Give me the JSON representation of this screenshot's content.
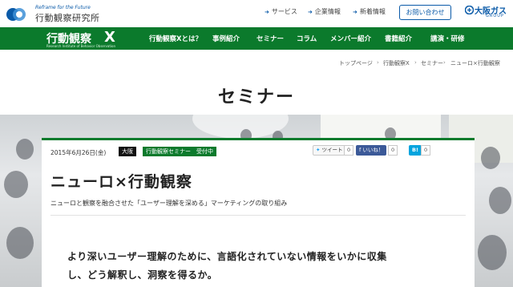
{
  "header": {
    "logo_tagline": "Reframe for the Future",
    "logo_name": "行動観察研究所",
    "utility_links": [
      "サービス",
      "企業情報",
      "新着情報"
    ],
    "contact_label": "お問い合わせ",
    "group_logo": "大阪ガス",
    "group_sub": "GROUP"
  },
  "nav": {
    "logo_text": "行動観察",
    "logo_x": "X",
    "logo_sub": "Research Institute of Behavior Observation",
    "items": [
      "行動観察Xとは？",
      "事例紹介",
      "セミナー",
      "コラム",
      "メンバー紹介",
      "書籍紹介",
      "講演・研修"
    ]
  },
  "breadcrumb": [
    "トップページ",
    "行動観察X",
    "セミナー",
    "ニューロ×行動観察"
  ],
  "page_title": "セミナー",
  "article": {
    "date": "2015年6月26日(金)",
    "area_tag": "大阪",
    "category_tag": "行動観察セミナー　受付中",
    "share": {
      "tweet_label": "ツイート",
      "tweet_count": "0",
      "like_label": "いいね！",
      "like_count": "0",
      "hatena_label": "B!",
      "hatena_count": "0"
    },
    "title": "ニューロ×行動観察",
    "subtitle": "ニューロと観察を融合させた「ユーザー理解を深める」マーケティングの取り組み",
    "lead_line1": "より深いユーザー理解のために、言語化されていない情報をいかに収集",
    "lead_line2": "し、どう解釈し、洞察を得るか。"
  },
  "colors": {
    "brand_green": "#0b7a2c",
    "brand_blue": "#0a5aa8"
  }
}
